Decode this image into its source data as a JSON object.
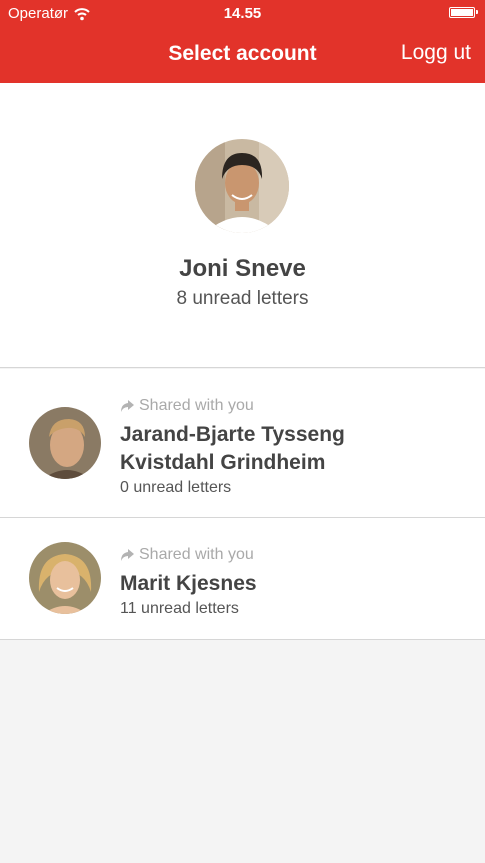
{
  "status_bar": {
    "carrier": "Operatør",
    "time": "14.55"
  },
  "nav": {
    "title": "Select account",
    "logout_label": "Logg ut"
  },
  "primary_account": {
    "name": "Joni Sneve",
    "unread": "8 unread letters"
  },
  "shared_accounts": [
    {
      "shared_label": "Shared with you",
      "name_line1": "Jarand-Bjarte Tysseng",
      "name_line2": "Kvistdahl Grindheim",
      "unread": "0 unread letters"
    },
    {
      "shared_label": "Shared with you",
      "name_line1": "Marit Kjesnes",
      "unread": "11 unread letters"
    }
  ],
  "colors": {
    "accent": "#e2332a",
    "background": "#f4f4f4"
  }
}
